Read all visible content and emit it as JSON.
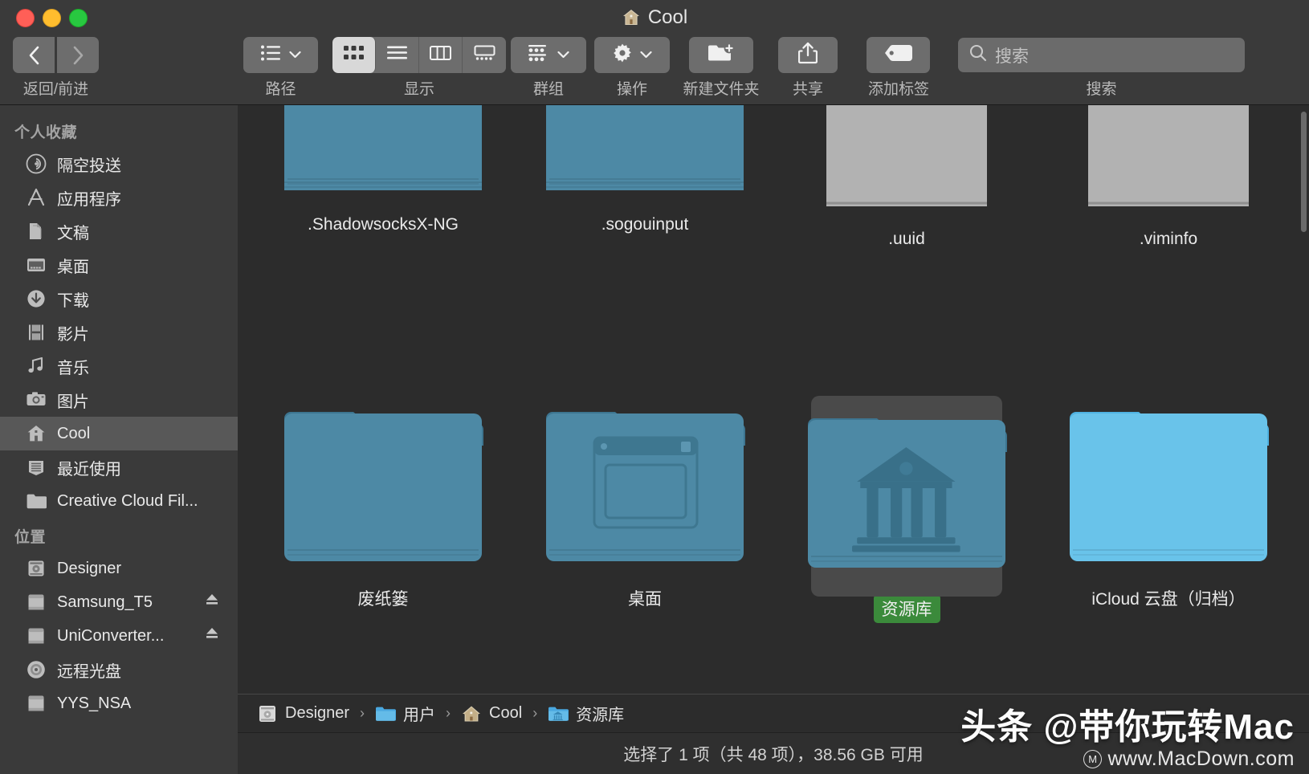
{
  "window": {
    "title": "Cool",
    "title_icon": "home-icon"
  },
  "traffic_lights": {
    "close": "close-button",
    "minimize": "minimize-button",
    "maximize": "maximize-button"
  },
  "toolbar": {
    "nav": {
      "back_icon": "chevron-left-icon",
      "forward_icon": "chevron-right-icon",
      "label": "返回/前进"
    },
    "path": {
      "icon": "list-bullet-icon",
      "chevron": "chevron-down-icon",
      "label": "路径"
    },
    "view": {
      "label": "显示",
      "options": [
        {
          "name": "icon-view",
          "icon": "grid-icon",
          "selected": true
        },
        {
          "name": "list-view",
          "icon": "list-icon",
          "selected": false
        },
        {
          "name": "column-view",
          "icon": "columns-icon",
          "selected": false
        },
        {
          "name": "gallery-view",
          "icon": "gallery-icon",
          "selected": false
        }
      ]
    },
    "group": {
      "icon": "group-icon",
      "chevron": "chevron-down-icon",
      "label": "群组"
    },
    "action": {
      "icon": "gear-icon",
      "chevron": "chevron-down-icon",
      "label": "操作"
    },
    "new_folder": {
      "icon": "new-folder-icon",
      "label": "新建文件夹"
    },
    "share": {
      "icon": "share-icon",
      "label": "共享"
    },
    "add_tag": {
      "icon": "tag-icon",
      "label": "添加标签"
    },
    "search": {
      "icon": "search-icon",
      "placeholder": "搜索",
      "value": "",
      "label": "搜索"
    }
  },
  "sidebar": {
    "sections": [
      {
        "header": "个人收藏",
        "items": [
          {
            "label": "隔空投送",
            "icon": "airdrop-icon",
            "selected": false,
            "eject": false
          },
          {
            "label": "应用程序",
            "icon": "applications-icon",
            "selected": false,
            "eject": false
          },
          {
            "label": "文稿",
            "icon": "documents-icon",
            "selected": false,
            "eject": false
          },
          {
            "label": "桌面",
            "icon": "desktop-icon",
            "selected": false,
            "eject": false
          },
          {
            "label": "下载",
            "icon": "downloads-icon",
            "selected": false,
            "eject": false
          },
          {
            "label": "影片",
            "icon": "movies-icon",
            "selected": false,
            "eject": false
          },
          {
            "label": "音乐",
            "icon": "music-icon",
            "selected": false,
            "eject": false
          },
          {
            "label": "图片",
            "icon": "pictures-icon",
            "selected": false,
            "eject": false
          },
          {
            "label": "Cool",
            "icon": "home-icon",
            "selected": true,
            "eject": false
          },
          {
            "label": "最近使用",
            "icon": "recents-icon",
            "selected": false,
            "eject": false
          },
          {
            "label": "Creative Cloud Fil...",
            "icon": "folder-icon",
            "selected": false,
            "eject": false
          }
        ]
      },
      {
        "header": "位置",
        "items": [
          {
            "label": "Designer",
            "icon": "harddisk-icon",
            "selected": false,
            "eject": false
          },
          {
            "label": "Samsung_T5",
            "icon": "external-disk-icon",
            "selected": false,
            "eject": true
          },
          {
            "label": "UniConverter...",
            "icon": "external-disk-icon",
            "selected": false,
            "eject": true
          },
          {
            "label": "远程光盘",
            "icon": "optical-disc-icon",
            "selected": false,
            "eject": false
          },
          {
            "label": "YYS_NSA",
            "icon": "external-disk-icon",
            "selected": false,
            "eject": false
          }
        ]
      }
    ]
  },
  "files": [
    {
      "name": ".ShadowsocksX-NG",
      "kind": "folder",
      "tint": "teal",
      "selected": false,
      "tag": null,
      "emblem": null,
      "clipped_top": true
    },
    {
      "name": ".sogouinput",
      "kind": "folder",
      "tint": "teal",
      "selected": false,
      "tag": null,
      "emblem": null,
      "clipped_top": true
    },
    {
      "name": ".uuid",
      "kind": "document",
      "tint": "grey",
      "selected": false,
      "tag": null,
      "emblem": null,
      "clipped_top": true
    },
    {
      "name": ".viminfo",
      "kind": "document",
      "tint": "grey",
      "selected": false,
      "tag": null,
      "emblem": null,
      "clipped_top": true
    },
    {
      "name": "废纸篓",
      "kind": "folder",
      "tint": "teal",
      "selected": false,
      "tag": null,
      "emblem": null,
      "clipped_top": false
    },
    {
      "name": "桌面",
      "kind": "folder",
      "tint": "teal",
      "selected": false,
      "tag": null,
      "emblem": "desktop-window-emblem",
      "clipped_top": false
    },
    {
      "name": "资源库",
      "kind": "folder",
      "tint": "teal",
      "selected": true,
      "tag": "green",
      "emblem": "library-building-emblem",
      "clipped_top": false
    },
    {
      "name": "iCloud 云盘（归档）",
      "kind": "folder",
      "tint": "blue",
      "selected": false,
      "tag": null,
      "emblem": null,
      "clipped_top": false
    }
  ],
  "path_bar": {
    "crumbs": [
      {
        "label": "Designer",
        "icon": "harddisk-icon"
      },
      {
        "label": "用户",
        "icon": "folder-icon"
      },
      {
        "label": "Cool",
        "icon": "home-icon"
      },
      {
        "label": "资源库",
        "icon": "library-folder-icon"
      }
    ],
    "separator": "›"
  },
  "status_bar": {
    "text": "选择了 1 项（共 48 项），38.56 GB 可用"
  },
  "watermark": {
    "line1": "头条 @带你玩转Mac",
    "line2": "www.MacDown.com",
    "badge": "M"
  },
  "colors": {
    "toolbar_bg": "#3a3a3a",
    "content_bg": "#2c2c2c",
    "sidebar_bg": "#3a3a3a",
    "selection": "#585858",
    "tag_green": "#3b8a3b",
    "folder_teal": "#4a87a3",
    "folder_blue": "#68c0ea"
  }
}
